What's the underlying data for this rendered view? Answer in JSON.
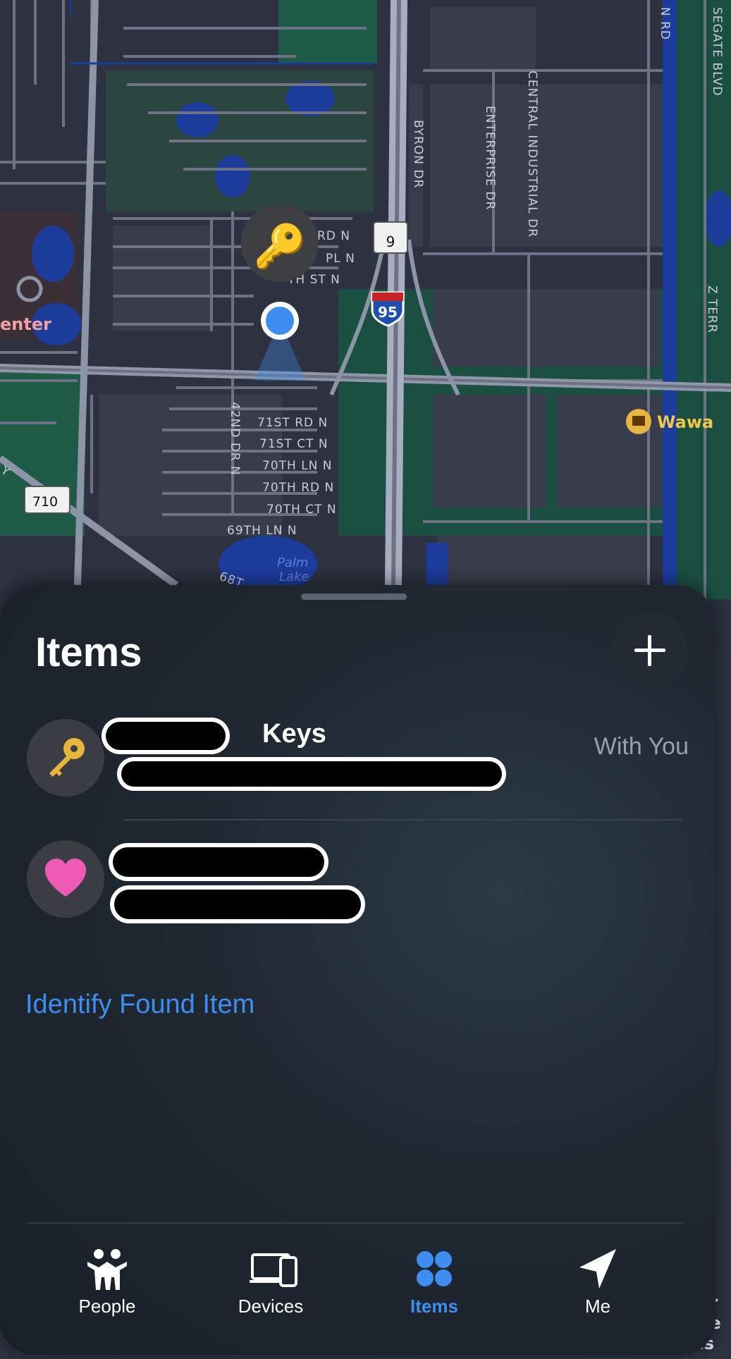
{
  "map": {
    "streets": [
      "RD N",
      "PL N",
      "TH ST N",
      "BYRON DR",
      "ENTERPRISE DR",
      "CENTRAL INDUSTRIAL DR",
      "N RD",
      "SEGATE BLVD",
      "Z TERR",
      "71ST RD N",
      "71ST CT N",
      "70TH LN N",
      "70TH RD N",
      "70TH CT N",
      "69TH LN N",
      "42ND DR N",
      "68T"
    ],
    "places": [
      "enter",
      "Wawa",
      "Palm Lake"
    ],
    "shields": [
      "9",
      "95",
      "710"
    ],
    "edge_text": [
      "or",
      "the",
      "aches"
    ]
  },
  "sheet": {
    "title": "Items",
    "add_label": "+"
  },
  "items": [
    {
      "name": "Keys",
      "status": "With You",
      "icon": "key-icon"
    },
    {
      "name": "",
      "status": "",
      "icon": "heart-icon"
    }
  ],
  "identify_label": "Identify Found Item",
  "tabs": [
    {
      "label": "People",
      "icon": "people-icon",
      "active": false
    },
    {
      "label": "Devices",
      "icon": "devices-icon",
      "active": false
    },
    {
      "label": "Items",
      "icon": "items-icon",
      "active": true
    },
    {
      "label": "Me",
      "icon": "me-icon",
      "active": false
    }
  ],
  "colors": {
    "accent": "#3d8ef0",
    "map_bg": "#2a2e3b",
    "park": "#1d5b47",
    "water": "#1c3c9c"
  }
}
